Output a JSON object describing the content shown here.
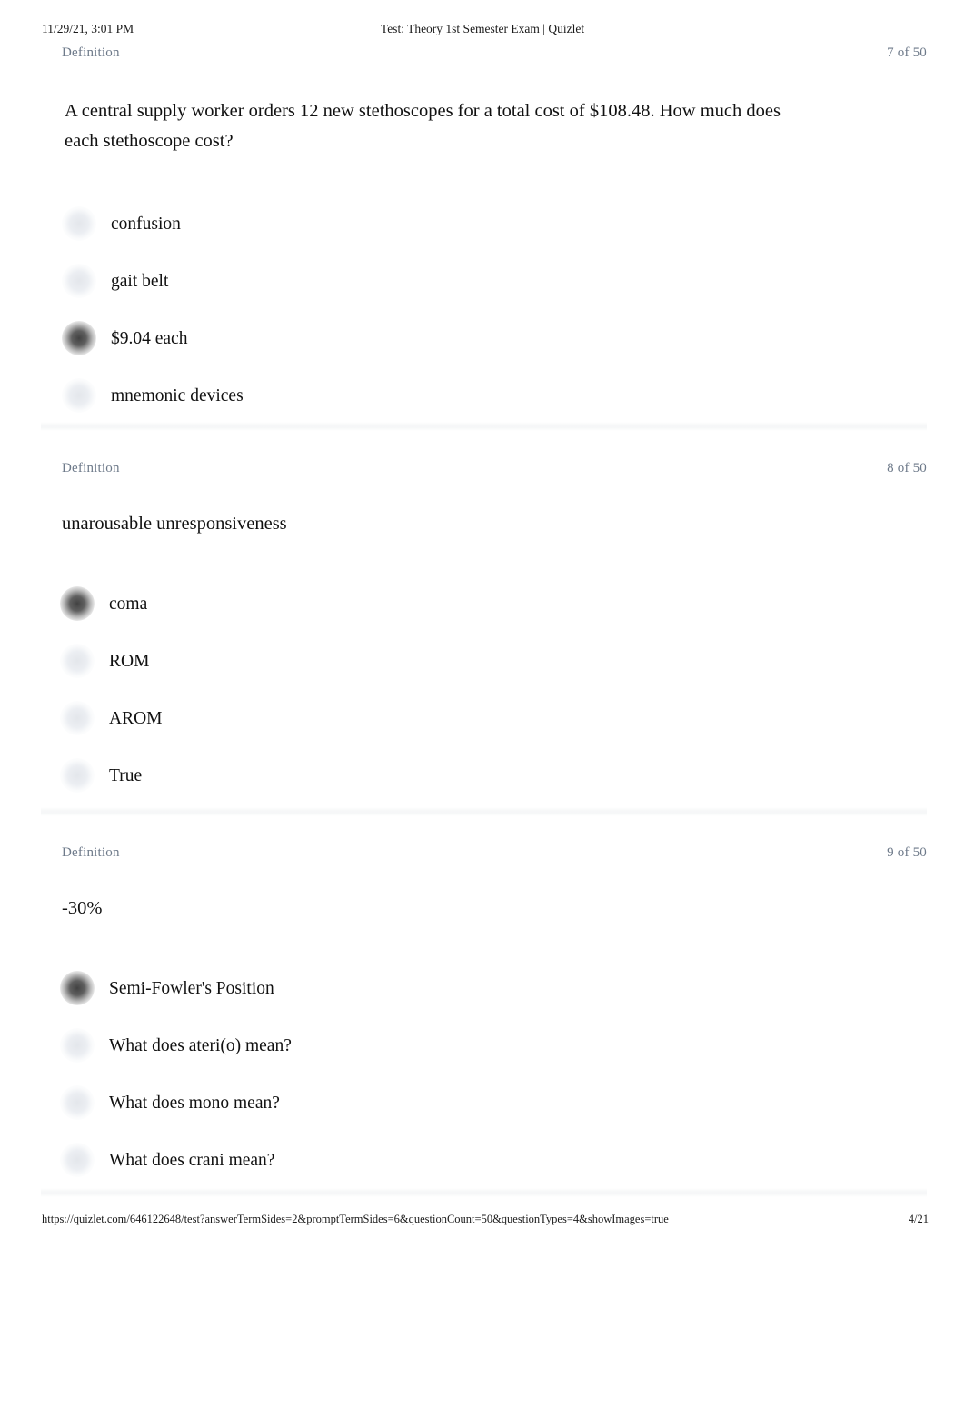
{
  "print_header": {
    "date": "11/29/21, 3:01 PM",
    "title": "Test: Theory 1st Semester Exam | Quizlet"
  },
  "print_footer": {
    "url": "https://quizlet.com/646122648/test?answerTermSides=2&promptTermSides=6&questionCount=50&questionTypes=4&showImages=true",
    "page": "4/21"
  },
  "colors": {
    "meta_text": "#6e7a8a",
    "body_text": "#111111",
    "separator": "#f5f6f7",
    "radio_selected": "#3a3a3a",
    "radio_unselected": "#e8ebf0"
  },
  "questions": [
    {
      "section_label": "Definition",
      "counter": "7 of 50",
      "prompt": "A central supply worker orders 12 new stethoscopes for a total cost of $108.48. How much does each stethoscope cost?",
      "options": [
        {
          "label": "confusion",
          "selected": false
        },
        {
          "label": "gait belt",
          "selected": false
        },
        {
          "label": "$9.04 each",
          "selected": true
        },
        {
          "label": "mnemonic devices",
          "selected": false
        }
      ]
    },
    {
      "section_label": "Definition",
      "counter": "8 of 50",
      "prompt": "unarousable unresponsiveness",
      "options": [
        {
          "label": "coma",
          "selected": true
        },
        {
          "label": "ROM",
          "selected": false
        },
        {
          "label": "AROM",
          "selected": false
        },
        {
          "label": "True",
          "selected": false
        }
      ]
    },
    {
      "section_label": "Definition",
      "counter": "9 of 50",
      "prompt": "-30%",
      "options": [
        {
          "label": "Semi-Fowler's Position",
          "selected": true
        },
        {
          "label": "What does ateri(o) mean?",
          "selected": false
        },
        {
          "label": "What does mono mean?",
          "selected": false
        },
        {
          "label": "What does crani mean?",
          "selected": false
        }
      ]
    }
  ]
}
